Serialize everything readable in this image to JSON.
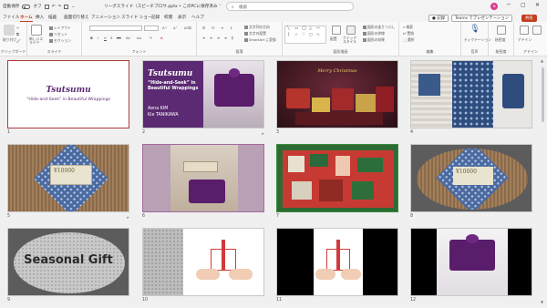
{
  "titlebar": {
    "autosave_label": "自動保存",
    "autosave_state": "オフ",
    "doc_title": "リーグスライド（スピーチプロサ.pptx • このPCに保存済み ˅",
    "search_placeholder": "検索",
    "avatar_initial": "Te"
  },
  "tabs": [
    "ファイル",
    "ホーム",
    "挿入",
    "描画",
    "画面切り替え",
    "アニメーション",
    "スライド ショー",
    "記録",
    "校閲",
    "表示",
    "ヘルプ"
  ],
  "active_tab": "ホーム",
  "right_buttons": {
    "record": "記録",
    "teams": "Teams でプレゼンテーション",
    "share": "共有"
  },
  "ribbon": {
    "groups": [
      "クリップボード",
      "スライド",
      "フォント",
      "段落",
      "図形描画",
      "編集",
      "音声",
      "秘密度",
      "アドイン"
    ],
    "clipboard_paste": "貼り付け",
    "slide_new": "新しいスライド",
    "slide_layout": "レイアウト",
    "slide_reset": "リセット",
    "slide_section": "セクション",
    "para_text_direction": "文字列の方向",
    "para_align_text": "文字の配置",
    "para_smartart": "SmartArt に変換",
    "drawing_arrange": "配置",
    "drawing_quick_styles": "クイック スタイル",
    "drawing_fill": "図形の塗りつぶし",
    "drawing_outline": "図形の枠線",
    "drawing_effects": "図形の効果",
    "edit_find": "検索",
    "edit_replace": "置換",
    "edit_select": "選択",
    "voice_dictate": "ディクテーション",
    "sensitivity": "秘密度",
    "addins": "アドイン"
  },
  "slides": [
    {
      "num": "1",
      "title": "Tsutsumu",
      "subtitle": "“Hide-and-Seek” in Beautiful Wrappings"
    },
    {
      "num": "2",
      "title": "Tsutsumu",
      "subtitle": "“Hide-and-Seek” in Beautiful Wrappings",
      "author1": "Aena KIM",
      "author2": "Kie TANIKAWA"
    },
    {
      "num": "3",
      "caption": "Merry Christmas"
    },
    {
      "num": "4"
    },
    {
      "num": "5",
      "bill": "¥10000"
    },
    {
      "num": "6"
    },
    {
      "num": "7"
    },
    {
      "num": "8",
      "bill": "¥10000"
    },
    {
      "num": "9",
      "title": "Seasonal Gift"
    },
    {
      "num": "10"
    },
    {
      "num": "11"
    },
    {
      "num": "12"
    }
  ],
  "colors": {
    "accent": "#c43e1c",
    "purple": "#5b2a72",
    "slide_sel_border": "#b23a3a"
  }
}
